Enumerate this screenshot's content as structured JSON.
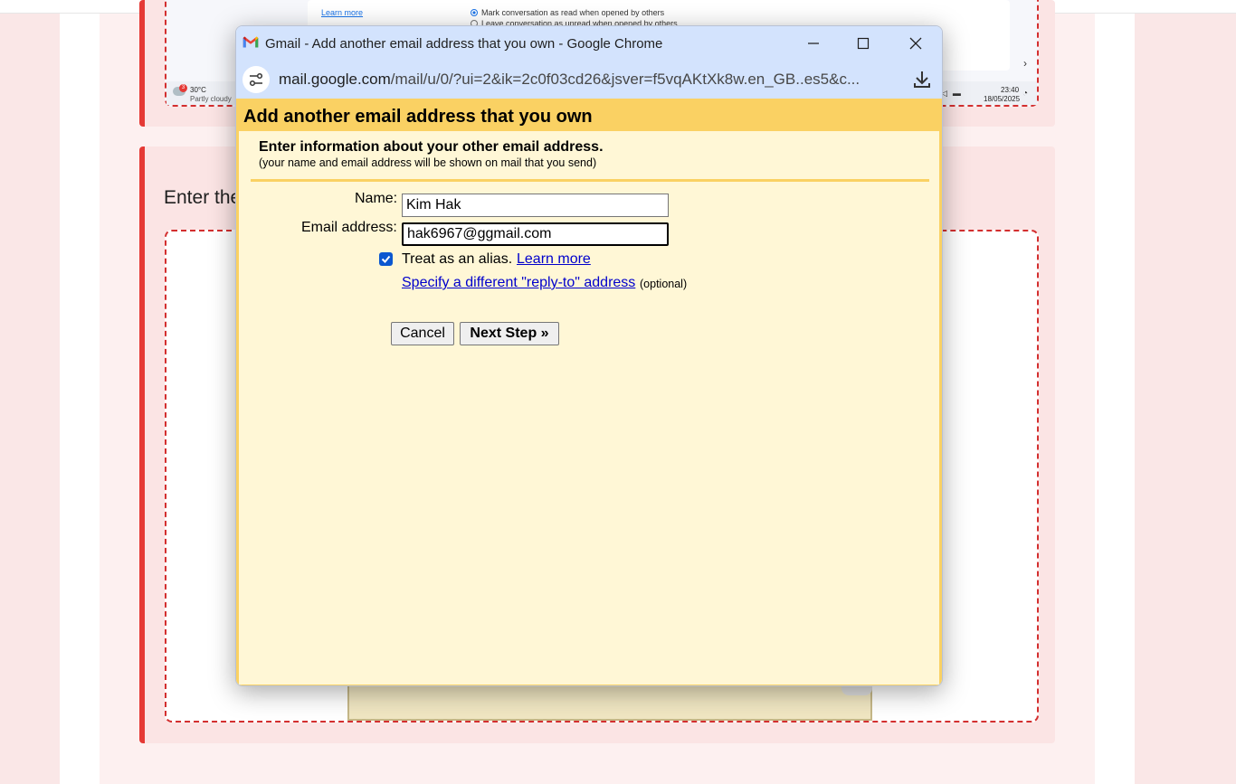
{
  "background": {
    "snapshot": {
      "learn_more": "Learn more",
      "option_read": "Mark conversation as read when opened by others",
      "option_unread": "Leave conversation as unread when opened by others",
      "weather_badge": "3",
      "weather_temp": "30°C",
      "weather_desc": "Partly cloudy",
      "clock_time": "23:40",
      "clock_date": "18/05/2025"
    },
    "section_heading": "Enter the"
  },
  "window": {
    "title": "Gmail - Add another email address that you own - Google Chrome",
    "url_host": "mail.google.com",
    "url_path": "/mail/u/0/?ui=2&ik=2c0f03cd26&jsver=f5vqAKtXk8w.en_GB..es5&c..."
  },
  "dialog": {
    "title": "Add another email address that you own",
    "subtitle": "Enter information about your other email address.",
    "note": "(your name and email address will be shown on mail that you send)",
    "name_label": "Name:",
    "name_value": "Kim Hak",
    "email_label": "Email address:",
    "email_value": "hak6967@ggmail.com",
    "alias_label": "Treat as an alias.",
    "alias_checked": true,
    "learn_more": "Learn more",
    "replyto_link": "Specify a different \"reply-to\" address",
    "optional_note": "(optional)",
    "cancel_label": "Cancel",
    "next_label": "Next Step »"
  },
  "colors": {
    "dialog_bg": "#fff7d6",
    "dialog_header": "#fad163",
    "chrome_frame": "#d3e3fd",
    "link": "#0000cc",
    "card_accent": "#e53935"
  }
}
